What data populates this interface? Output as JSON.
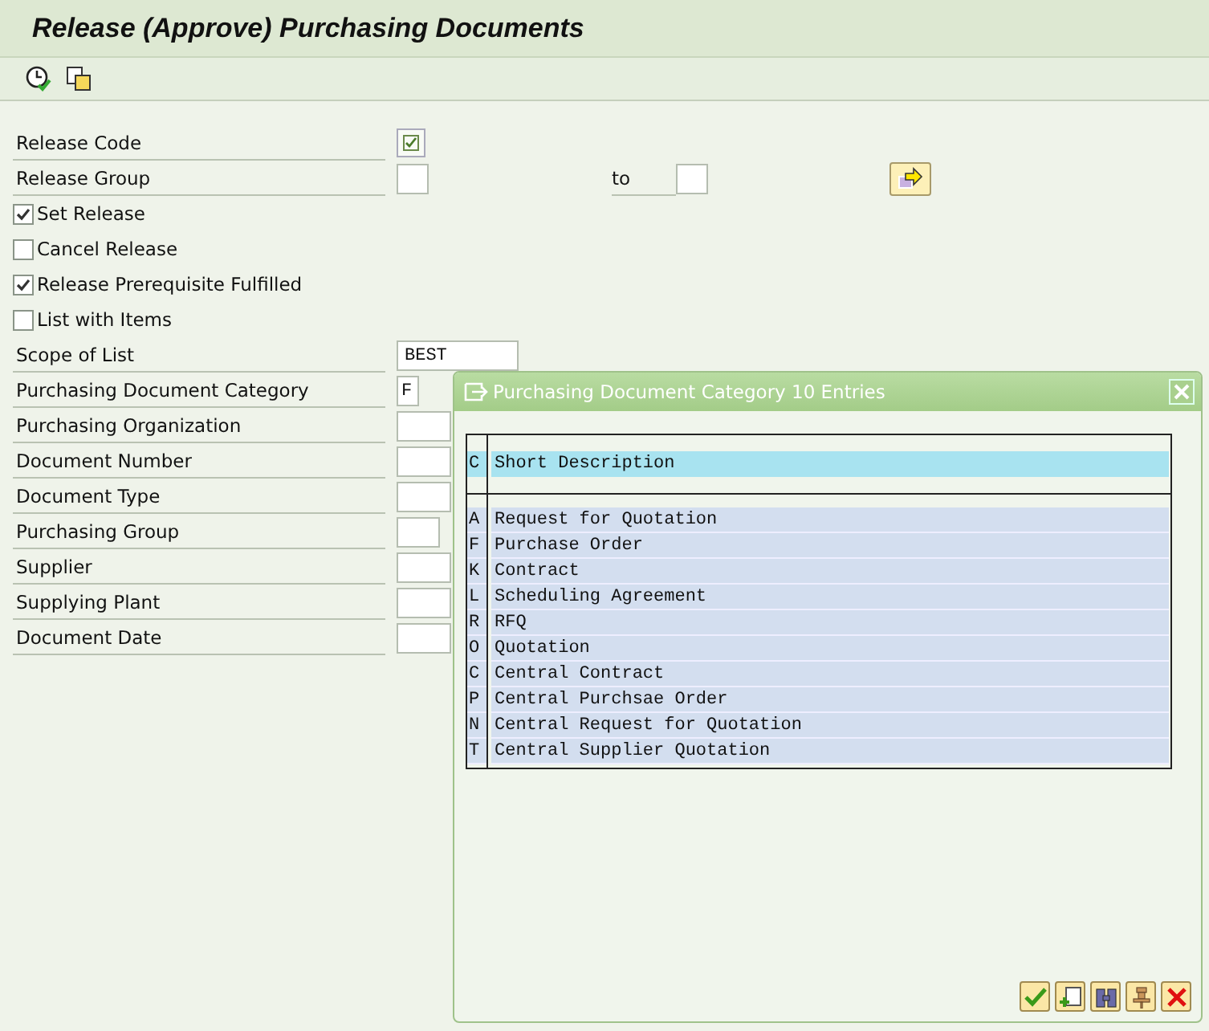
{
  "window": {
    "title": "Release (Approve) Purchasing Documents"
  },
  "form": [
    {
      "kind": "checkfield",
      "label": "Release Code",
      "checked": true
    },
    {
      "kind": "range",
      "label": "Release Group",
      "to_label": "to"
    },
    {
      "kind": "check",
      "label": "Set Release",
      "checked": true
    },
    {
      "kind": "check",
      "label": "Cancel Release",
      "checked": false
    },
    {
      "kind": "check",
      "label": "Release Prerequisite Fulfilled",
      "checked": true
    },
    {
      "kind": "check",
      "label": "List with Items",
      "checked": false
    },
    {
      "kind": "field",
      "label": "Scope of List",
      "value": "BEST"
    },
    {
      "kind": "field",
      "label": "Purchasing Document Category",
      "value": "F"
    },
    {
      "kind": "field",
      "label": "Purchasing Organization"
    },
    {
      "kind": "field",
      "label": "Document Number"
    },
    {
      "kind": "field",
      "label": "Document Type"
    },
    {
      "kind": "field",
      "label": "Purchasing Group"
    },
    {
      "kind": "field",
      "label": "Supplier"
    },
    {
      "kind": "field",
      "label": "Supplying Plant"
    },
    {
      "kind": "field",
      "label": "Document Date"
    }
  ],
  "dialog": {
    "title": "Purchasing Document Category 10 Entries",
    "columns": [
      "C",
      "Short Description"
    ],
    "rows": [
      [
        "A",
        "Request for Quotation"
      ],
      [
        "F",
        "Purchase Order"
      ],
      [
        "K",
        "Contract"
      ],
      [
        "L",
        "Scheduling Agreement"
      ],
      [
        "R",
        "RFQ"
      ],
      [
        "O",
        "Quotation"
      ],
      [
        "C",
        "Central Contract"
      ],
      [
        "P",
        "Central Purchsae Order"
      ],
      [
        "N",
        "Central Request for Quotation"
      ],
      [
        "T",
        "Central Supplier Quotation"
      ]
    ]
  }
}
